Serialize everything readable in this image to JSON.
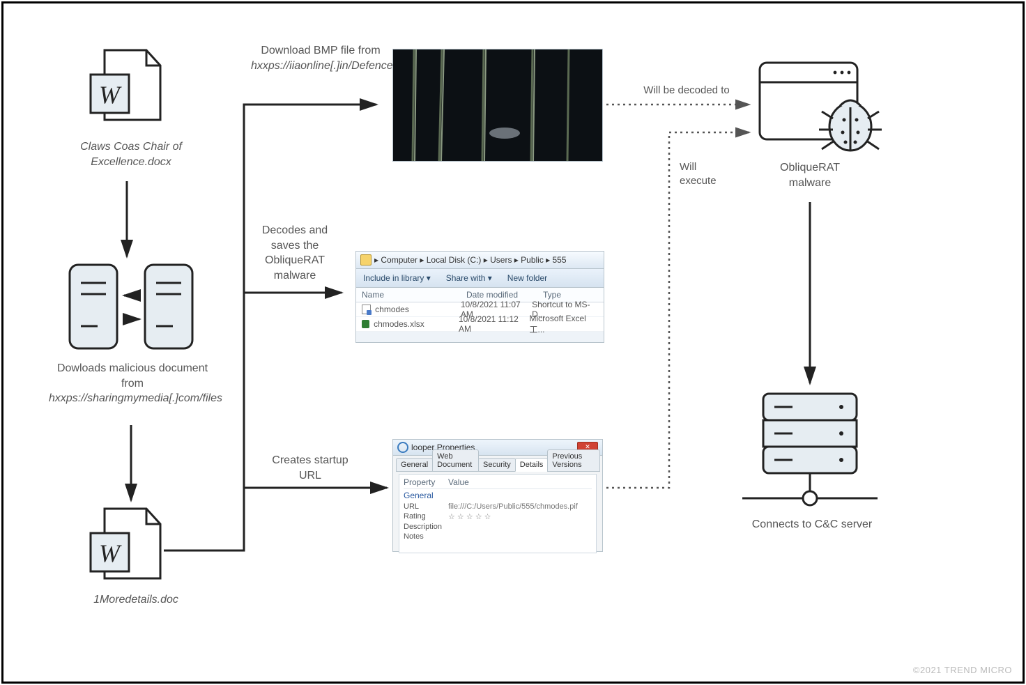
{
  "nodes": {
    "docx_label": "Claws Coas Chair of Excellence.docx",
    "download_mal": "Dowloads malicious document from",
    "download_mal_url": "hxxps://sharingmymedia[.]com/files",
    "doc2_label": "1Moredetails.doc",
    "bmp_label_1": "Download BMP file from",
    "bmp_label_2": "hxxps://iiaonline[.]in/DefenceLogo/theta[.]bmp",
    "decode_label": "Decodes and saves the ObliqueRAT malware",
    "startup_label": "Creates startup URL",
    "decoded_label": "Will be decoded to",
    "execute_label": "Will execute",
    "rat_label": "ObliqueRAT malware",
    "c2_label": "Connects to C&C server"
  },
  "explorer": {
    "breadcrumb": [
      "Computer",
      "Local Disk (C:)",
      "Users",
      "Public",
      "555"
    ],
    "toolbar": [
      "Include in library ▾",
      "Share with ▾",
      "New folder"
    ],
    "columns": [
      "Name",
      "Date modified",
      "Type"
    ],
    "rows": [
      {
        "icon": "shortcut",
        "name": "chmodes",
        "date": "10/8/2021 11:07 AM",
        "type": "Shortcut to MS-D..."
      },
      {
        "icon": "excel",
        "name": "chmodes.xlsx",
        "date": "10/8/2021 11:12 AM",
        "type": "Microsoft Excel 工..."
      }
    ]
  },
  "props": {
    "title": "looper Properties",
    "tabs": [
      "General",
      "Web Document",
      "Security",
      "Details",
      "Previous Versions"
    ],
    "active_tab": "Details",
    "headers": [
      "Property",
      "Value"
    ],
    "section": "General",
    "rows": [
      {
        "k": "URL",
        "v": "file:///C:/Users/Public/555/chmodes.pif"
      },
      {
        "k": "Rating",
        "v": "☆ ☆ ☆ ☆ ☆"
      },
      {
        "k": "Description",
        "v": ""
      },
      {
        "k": "Notes",
        "v": ""
      }
    ]
  },
  "credit": "©2021 TREND MICRO"
}
